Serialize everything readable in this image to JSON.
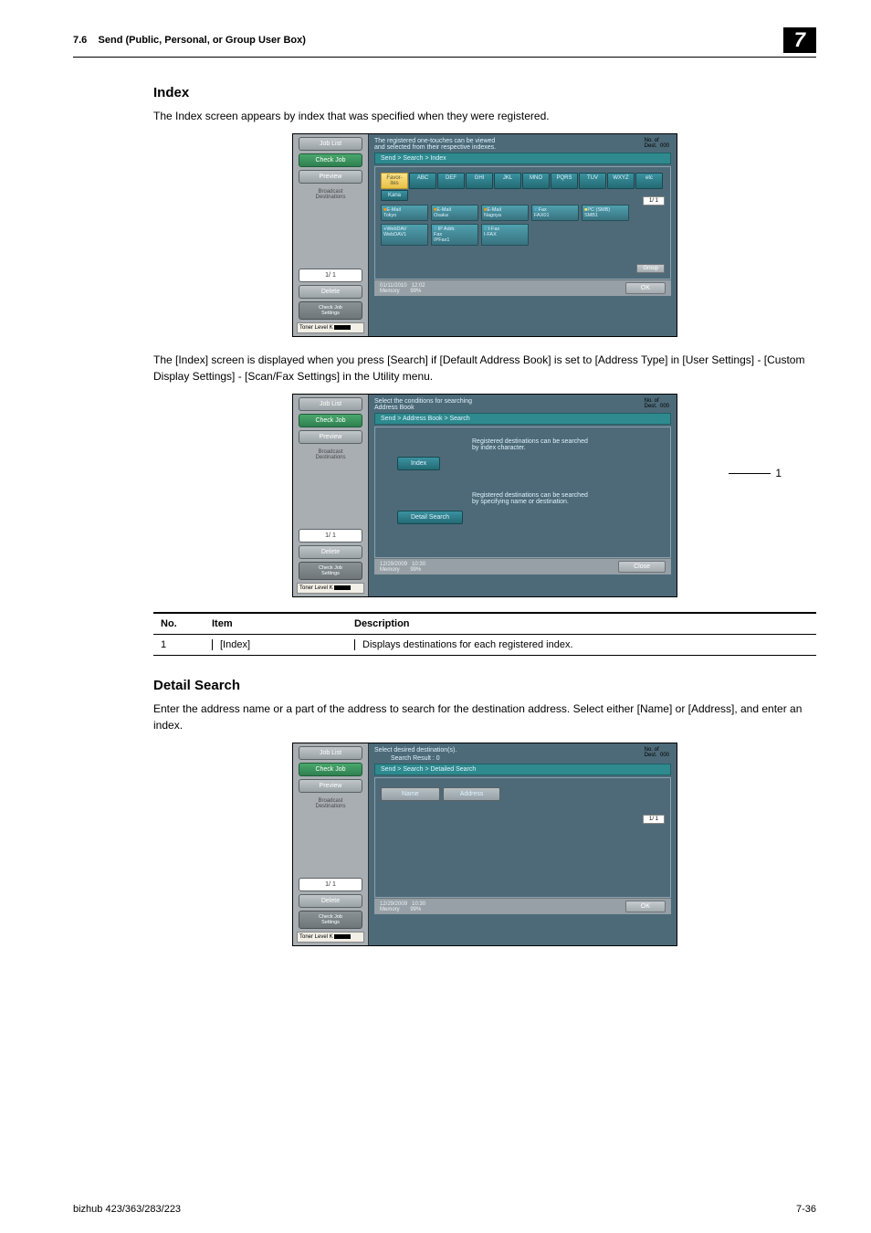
{
  "header": {
    "section": "7.6",
    "title": "Send (Public, Personal, or Group User Box)",
    "chapter": "7"
  },
  "h_index": "Index",
  "p1": "The Index screen appears by index that was specified when they were registered.",
  "p2": "The [Index] screen is displayed when you press [Search] if [Default Address Book] is set to [Address Type] in [User Settings] - [Custom Display Settings] - [Scan/Fax Settings] in the Utility menu.",
  "h_detail": "Detail Search",
  "p3": "Enter the address name or a part of the address to search for the destination address. Select either [Name] or [Address], and enter an index.",
  "callout1": "1",
  "table": {
    "h1": "No.",
    "h2": "Item",
    "h3": "Description",
    "r1c1": "1",
    "r1c2": "[Index]",
    "r1c3": "Displays destinations for each registered index."
  },
  "side": {
    "job_list": "Job List",
    "check_job": "Check Job",
    "preview": "Preview",
    "broadcast": "Broadcast\nDestinations",
    "page": "1/  1",
    "delete": "Delete",
    "check_set": "Check Job\nSettings",
    "toner": "Toner Level  K"
  },
  "scr1": {
    "msg": "The registered one-touches can be viewed\nand selected from their respective indexes.",
    "dest": "No. of\nDest.",
    "destn": "000",
    "crumb": "Send > Search > Index",
    "tabs": [
      "Favor-\nites",
      "ABC",
      "DEF",
      "GHI",
      "JKL",
      "MNO",
      "PQRS",
      "TUV",
      "WXYZ",
      "etc",
      "Kana"
    ],
    "cards": [
      {
        "a": "E-Mail",
        "b": "Tokyo"
      },
      {
        "a": "E-Mail",
        "b": "Osaka"
      },
      {
        "a": "E-Mail",
        "b": "Nagoya"
      },
      {
        "a": "Fax",
        "b": "FAX01"
      },
      {
        "a": "PC (SMB)",
        "b": "SMB1"
      },
      {
        "a": "WebDAV",
        "b": "WebDAV1"
      },
      {
        "a": "IP Addr.\nFax",
        "b": "IPFax1"
      },
      {
        "a": "I-Fax",
        "b": "I-FAX"
      }
    ],
    "page": "1/  1",
    "group": "Group",
    "date": "01/11/2010",
    "time": "12:02",
    "mem": "Memory",
    "memv": "99%",
    "ok": "OK"
  },
  "scr2": {
    "msg": "Select the conditions for searching\nAddress Book",
    "dest": "No. of\nDest.",
    "destn": "000",
    "crumb": "Send > Address Book > Search",
    "t1": "Registered destinations can be searched\nby index character.",
    "b1": "Index",
    "t2": "Registered destinations can be searched\nby specifying name or destination.",
    "b2": "Detail Search",
    "date": "12/29/2009",
    "time": "10:30",
    "mem": "Memory",
    "memv": "99%",
    "close": "Close"
  },
  "scr3": {
    "msg": "Select desired destination(s).",
    "dest": "No. of\nDest.",
    "destn": "000",
    "result": "Search Result  :    0",
    "crumb": "Send > Search > Detailed Search",
    "name": "Name",
    "addr": "Address",
    "page": "1/  1",
    "date": "12/29/2009",
    "time": "10:30",
    "mem": "Memory",
    "memv": "99%",
    "ok": "OK"
  },
  "footer": {
    "model": "bizhub 423/363/283/223",
    "page": "7-36"
  }
}
